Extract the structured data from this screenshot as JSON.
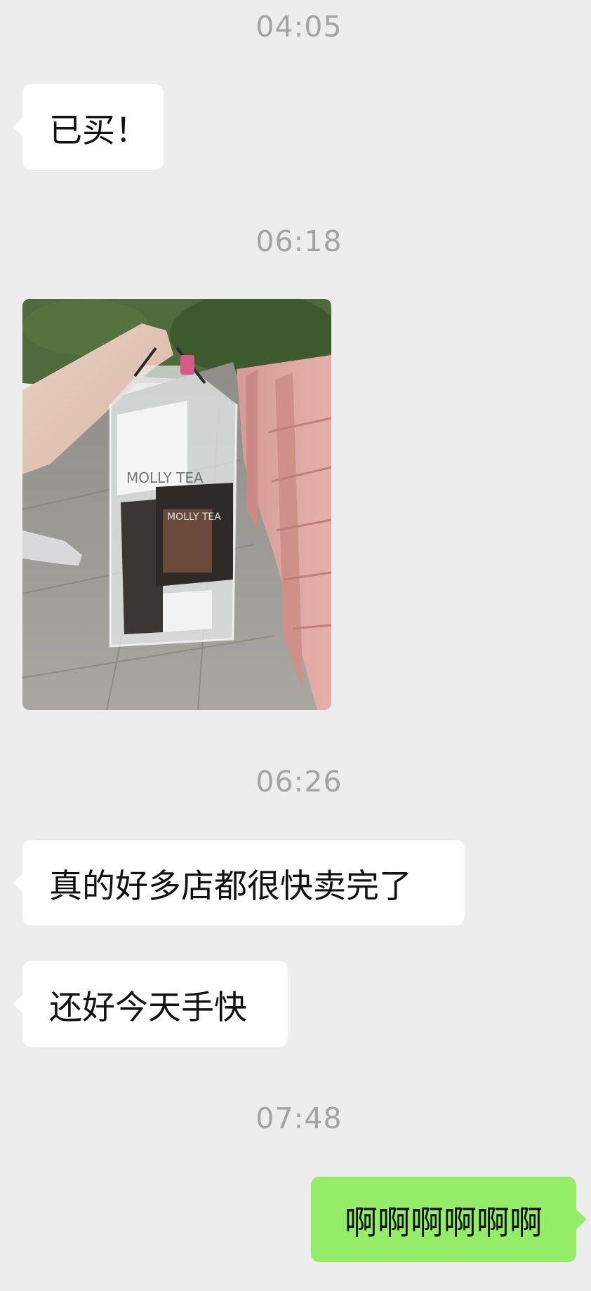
{
  "messages": [
    {
      "timestamp": "04:05"
    },
    {
      "text": "已买！",
      "direction": "incoming"
    },
    {
      "timestamp": "06:18"
    },
    {
      "image": "photo-shopping-bag",
      "direction": "incoming",
      "photo_text": "MOLLY TEA"
    },
    {
      "timestamp": "06:26"
    },
    {
      "text": "真的好多店都很快卖完了",
      "direction": "incoming"
    },
    {
      "text": "还好今天手快",
      "direction": "incoming"
    },
    {
      "timestamp": "07:48"
    },
    {
      "text": "啊啊啊啊啊啊",
      "direction": "outgoing"
    }
  ],
  "colors": {
    "background": "#ededed",
    "incoming_bubble": "#ffffff",
    "outgoing_bubble": "#95ec69",
    "timestamp": "#a3a3a3"
  }
}
